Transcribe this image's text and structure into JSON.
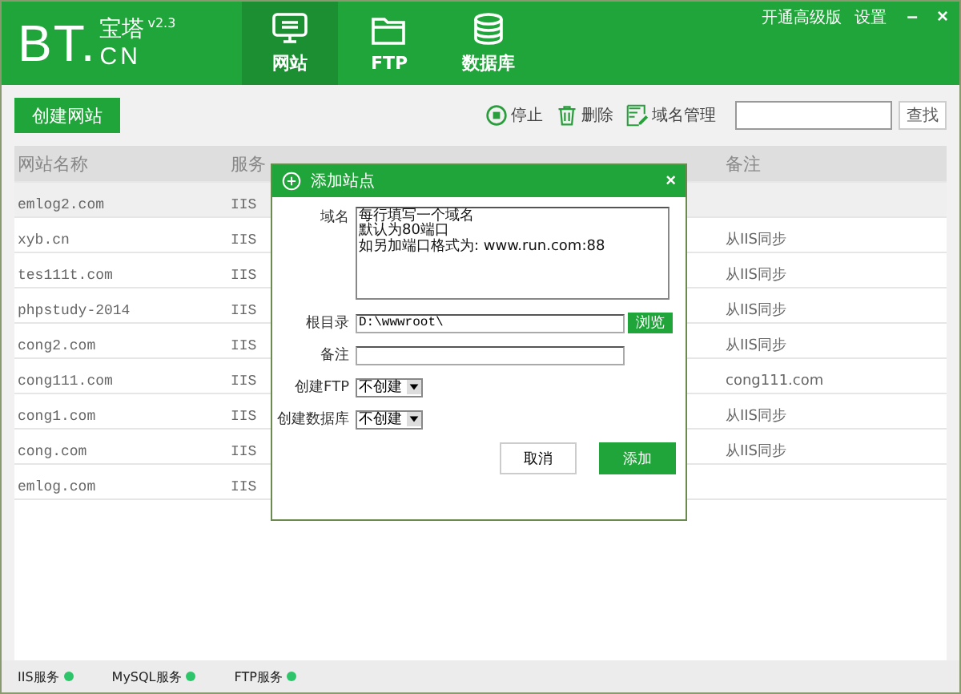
{
  "brand": {
    "logo": "BT.",
    "name": "宝塔",
    "domain": "CN",
    "version": "v2.3"
  },
  "top_links": [
    "开通高级版",
    "设置"
  ],
  "window_controls": [
    "–",
    "×"
  ],
  "tabs": [
    {
      "label": "网站",
      "selected": true
    },
    {
      "label": "FTP",
      "selected": false
    },
    {
      "label": "数据库",
      "selected": false
    }
  ],
  "toolbar": {
    "create_button": "创建网站",
    "actions": [
      "停止",
      "删除",
      "域名管理"
    ],
    "search_button": "查找"
  },
  "table": {
    "columns": [
      "网站名称",
      "服务",
      "备注"
    ],
    "rows": [
      {
        "name": "emlog2.com",
        "server": "IIS",
        "note": "",
        "selected": true
      },
      {
        "name": "xyb.cn",
        "server": "IIS",
        "note": "从IIS同步",
        "selected": false
      },
      {
        "name": "tes111t.com",
        "server": "IIS",
        "note": "从IIS同步",
        "selected": false
      },
      {
        "name": "phpstudy-2014",
        "server": "IIS",
        "note": "从IIS同步",
        "selected": false
      },
      {
        "name": "cong2.com",
        "server": "IIS",
        "note": "从IIS同步",
        "selected": false
      },
      {
        "name": "cong111.com",
        "server": "IIS",
        "note": "cong111.com",
        "selected": false
      },
      {
        "name": "cong1.com",
        "server": "IIS",
        "note": "从IIS同步",
        "selected": false
      },
      {
        "name": "cong.com",
        "server": "IIS",
        "note": "从IIS同步",
        "selected": false
      },
      {
        "name": "emlog.com",
        "server": "IIS",
        "note": "",
        "selected": false
      }
    ]
  },
  "dialog": {
    "title": "添加站点",
    "close": "×",
    "domain": {
      "label": "域名",
      "lines": [
        "每行填写一个域名",
        "默认为80端口",
        "如另加端口格式为: www.run.com:88"
      ]
    },
    "root": {
      "label": "根目录",
      "value": "D:\\wwwroot\\",
      "browse": "浏览"
    },
    "note": {
      "label": "备注"
    },
    "ftp": {
      "label": "创建FTP",
      "value": "不创建"
    },
    "database": {
      "label": "创建数据库",
      "value": "不创建"
    },
    "cancel": "取消",
    "submit": "添加"
  },
  "status_bar": [
    {
      "label": "IIS服务",
      "running": true
    },
    {
      "label": "MySQL服务",
      "running": true
    },
    {
      "label": "FTP服务",
      "running": true
    }
  ]
}
